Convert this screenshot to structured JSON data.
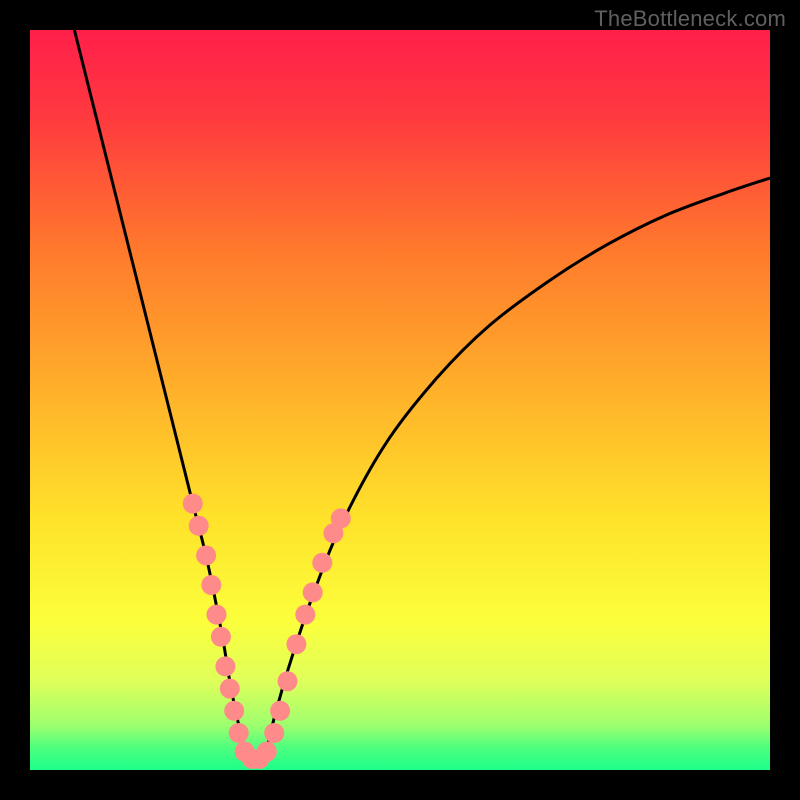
{
  "watermark": {
    "text": "TheBottleneck.com"
  },
  "chart_data": {
    "type": "line",
    "title": "",
    "xlabel": "",
    "ylabel": "",
    "xlim": [
      0,
      100
    ],
    "ylim": [
      0,
      100
    ],
    "grid": false,
    "legend": false,
    "gradient_stops": [
      {
        "offset": 0,
        "color": "#ff1f4a"
      },
      {
        "offset": 12,
        "color": "#ff3a3f"
      },
      {
        "offset": 30,
        "color": "#ff7a2c"
      },
      {
        "offset": 50,
        "color": "#ffb42a"
      },
      {
        "offset": 66,
        "color": "#ffe22a"
      },
      {
        "offset": 80,
        "color": "#fbff3c"
      },
      {
        "offset": 88,
        "color": "#dfff5a"
      },
      {
        "offset": 94,
        "color": "#9dff6e"
      },
      {
        "offset": 97,
        "color": "#4dff7e"
      },
      {
        "offset": 100,
        "color": "#1dff8a"
      }
    ],
    "series": [
      {
        "name": "bottleneck-curve",
        "color": "#000000",
        "x": [
          6,
          8,
          10,
          12,
          14,
          16,
          18,
          20,
          22,
          24,
          26,
          27,
          28,
          29,
          30,
          31,
          32,
          33,
          35,
          38,
          42,
          48,
          55,
          62,
          70,
          78,
          86,
          94,
          100
        ],
        "y": [
          100,
          92,
          84,
          76,
          68,
          60,
          52,
          44,
          36,
          28,
          18,
          12,
          7,
          3,
          1,
          1,
          3,
          7,
          14,
          23,
          33,
          44,
          53,
          60,
          66,
          71,
          75,
          78,
          80
        ]
      }
    ],
    "markers": {
      "color": "#ff8a8a",
      "radius": 10,
      "points": [
        {
          "x": 22.0,
          "y": 36
        },
        {
          "x": 22.8,
          "y": 33
        },
        {
          "x": 23.8,
          "y": 29
        },
        {
          "x": 24.5,
          "y": 25
        },
        {
          "x": 25.2,
          "y": 21
        },
        {
          "x": 25.8,
          "y": 18
        },
        {
          "x": 26.4,
          "y": 14
        },
        {
          "x": 27.0,
          "y": 11
        },
        {
          "x": 27.6,
          "y": 8
        },
        {
          "x": 28.2,
          "y": 5
        },
        {
          "x": 29.0,
          "y": 2.5
        },
        {
          "x": 30.0,
          "y": 1.5
        },
        {
          "x": 31.0,
          "y": 1.5
        },
        {
          "x": 32.0,
          "y": 2.5
        },
        {
          "x": 33.0,
          "y": 5
        },
        {
          "x": 33.8,
          "y": 8
        },
        {
          "x": 34.8,
          "y": 12
        },
        {
          "x": 36.0,
          "y": 17
        },
        {
          "x": 37.2,
          "y": 21
        },
        {
          "x": 38.2,
          "y": 24
        },
        {
          "x": 39.5,
          "y": 28
        },
        {
          "x": 41.0,
          "y": 32
        },
        {
          "x": 42.0,
          "y": 34
        }
      ]
    }
  }
}
